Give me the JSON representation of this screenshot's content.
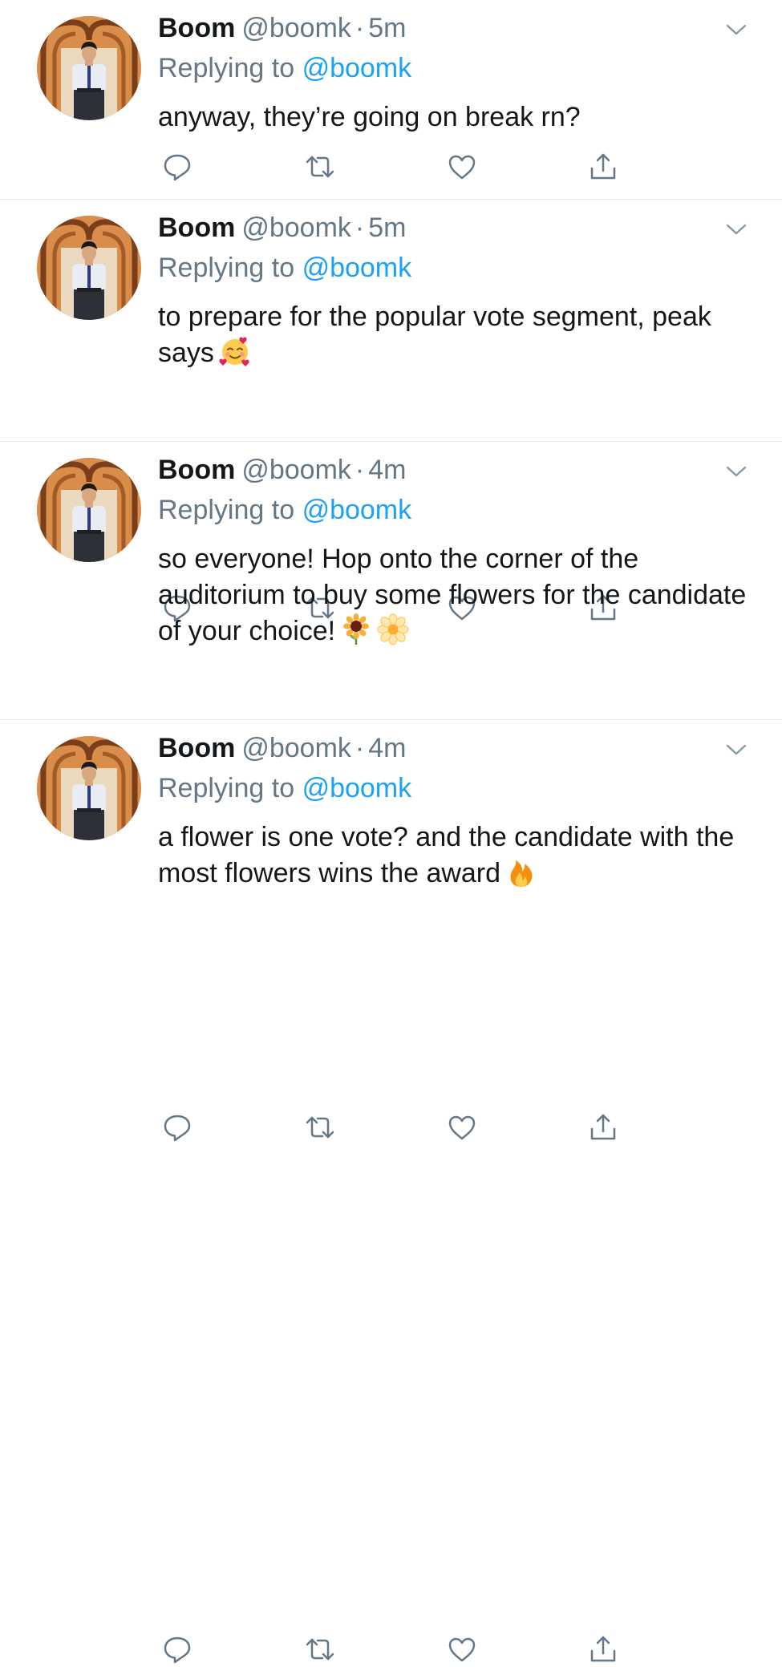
{
  "tweets": [
    {
      "name": "Boom",
      "handle": "@boomk",
      "separator": "·",
      "time": "5m",
      "replying_prefix": "Replying to",
      "replying_handle": "@boomk",
      "text": "anyway, they’re going on break rn?"
    },
    {
      "name": "Boom",
      "handle": "@boomk",
      "separator": "·",
      "time": "5m",
      "replying_prefix": "Replying to",
      "replying_handle": "@boomk",
      "text": "to prepare for the popular vote segment, peak says",
      "emoji": [
        "smiling-face-with-hearts-emoji"
      ]
    },
    {
      "name": "Boom",
      "handle": "@boomk",
      "separator": "·",
      "time": "4m",
      "replying_prefix": "Replying to",
      "replying_handle": "@boomk",
      "text": "so everyone! Hop onto the corner of the auditorium to buy some flowers for the candidate of your choice!",
      "emoji": [
        "sunflower-emoji",
        "blossom-emoji"
      ]
    },
    {
      "name": "Boom",
      "handle": "@boomk",
      "separator": "·",
      "time": "4m",
      "replying_prefix": "Replying to",
      "replying_handle": "@boomk",
      "text": "a flower is one vote? and the candidate with the most flowers wins the award",
      "emoji": [
        "fire-emoji"
      ]
    }
  ],
  "icons": {
    "reply": "reply-icon",
    "retweet": "retweet-icon",
    "like": "heart-icon",
    "share": "share-icon",
    "more": "chevron-down-icon"
  },
  "colors": {
    "text": "#14171a",
    "secondary": "#657786",
    "link": "#1da1f2",
    "divider": "#e1e8ed"
  }
}
